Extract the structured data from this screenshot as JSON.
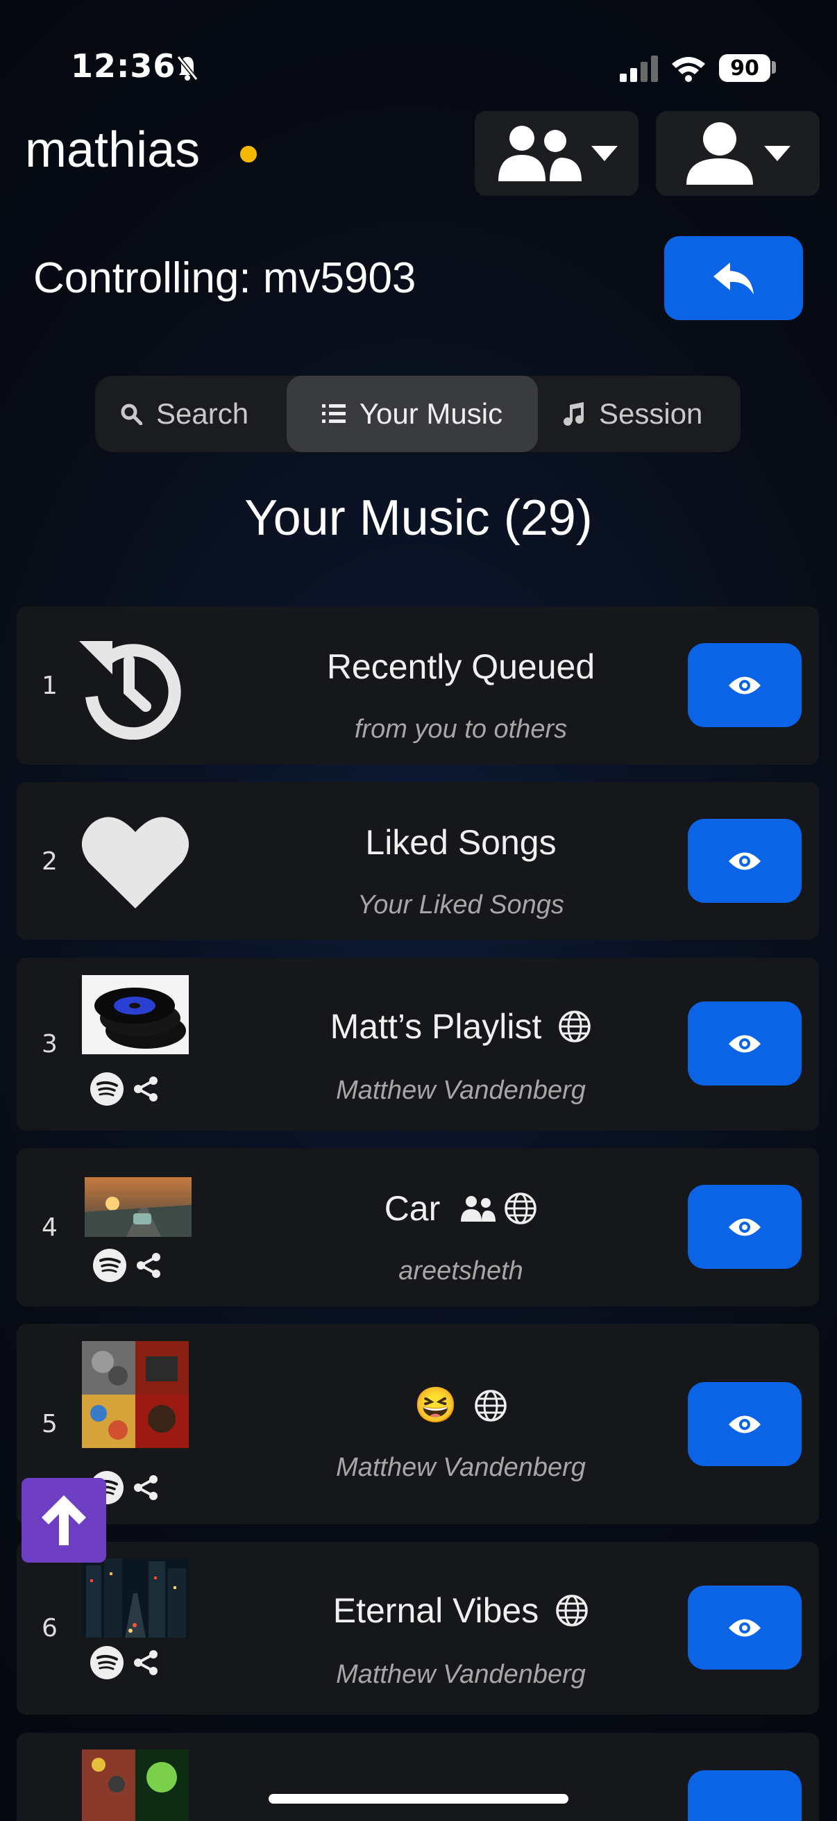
{
  "status_bar": {
    "time": "12:36",
    "battery": "90"
  },
  "header": {
    "username": "mathias",
    "online_color": "#f5b800"
  },
  "controlling": {
    "label": "Controlling:",
    "device": "mv5903"
  },
  "tabs": [
    {
      "label": "Search",
      "icon": "search-icon",
      "active": false
    },
    {
      "label": "Your Music",
      "icon": "list-icon",
      "active": true
    },
    {
      "label": "Session",
      "icon": "music-note-icon",
      "active": false
    }
  ],
  "section": {
    "title": "Your Music (29)"
  },
  "playlists": [
    {
      "num": "1",
      "title": "Recently Queued",
      "subtitle": "from you to others",
      "icon": "history-icon"
    },
    {
      "num": "2",
      "title": "Liked Songs",
      "subtitle": "Your Liked Songs",
      "icon": "heart-icon"
    },
    {
      "num": "3",
      "title": "Matt’s Playlist",
      "subtitle": "Matthew Vandenberg",
      "icon": "vinyl-records-art"
    },
    {
      "num": "4",
      "title": "Car",
      "subtitle": "areetsheth",
      "icon": "car-road-art"
    },
    {
      "num": "5",
      "title": "😆",
      "subtitle": "Matthew Vandenberg",
      "icon": "album-collage-art"
    },
    {
      "num": "6",
      "title": "Eternal Vibes",
      "subtitle": "Matthew Vandenberg",
      "icon": "city-night-art"
    }
  ],
  "colors": {
    "accent": "#0b63e5",
    "scroll_top": "#6f3fc3",
    "row_bg": "#16171a"
  }
}
